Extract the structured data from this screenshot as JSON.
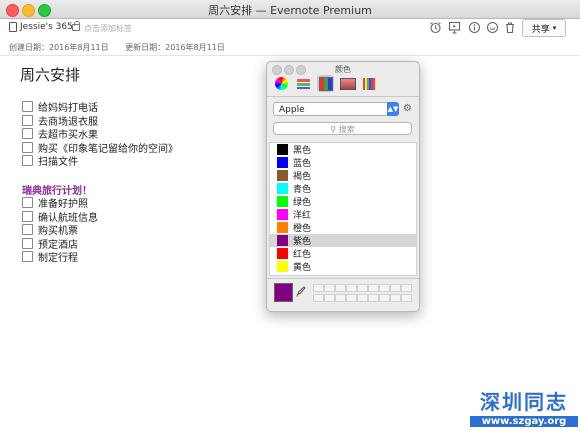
{
  "window": {
    "title": "周六安排 — Evernote Premium"
  },
  "toolbar": {
    "notebook": "Jessie's 365",
    "tag_placeholder": "点击添加标签",
    "share_label": "共享"
  },
  "dates": {
    "created": "创建日期：2016年8月11日",
    "updated": "更新日期：2016年8月11日"
  },
  "note": {
    "title": "周六安排",
    "todos": [
      {
        "label": "给妈妈打电话",
        "checked": false
      },
      {
        "label": "去商场退衣服",
        "checked": false
      },
      {
        "label": "去超市买水果",
        "checked": false
      },
      {
        "label": "购买《印象笔记留给你的空间》",
        "checked": false
      },
      {
        "label": "扫描文件",
        "checked": false
      }
    ],
    "section_title": "瑞典旅行计划！",
    "section_color": "#8a2d96",
    "travel_todos": [
      {
        "label": "准备好护照",
        "checked": false
      },
      {
        "label": "确认航班信息",
        "checked": false
      },
      {
        "label": "购买机票",
        "checked": false
      },
      {
        "label": "预定酒店",
        "checked": false
      },
      {
        "label": "制定行程",
        "checked": false
      }
    ]
  },
  "color_panel": {
    "title": "颜色",
    "palette_name": "Apple",
    "search_placeholder": "搜索",
    "colors": [
      {
        "name": "黑色",
        "hex": "#000000"
      },
      {
        "name": "蓝色",
        "hex": "#0000ff"
      },
      {
        "name": "褐色",
        "hex": "#8b5a2b"
      },
      {
        "name": "青色",
        "hex": "#00ffff"
      },
      {
        "name": "绿色",
        "hex": "#00ff00"
      },
      {
        "name": "洋红",
        "hex": "#ff00ff"
      },
      {
        "name": "橙色",
        "hex": "#ff8000"
      },
      {
        "name": "紫色",
        "hex": "#800080"
      },
      {
        "name": "红色",
        "hex": "#ff0000"
      },
      {
        "name": "黄色",
        "hex": "#ffff00"
      }
    ],
    "selected_index": 7,
    "current_color": "#7f0080"
  },
  "watermark": {
    "line1": "深圳同志",
    "line2": "www.szgay.org"
  }
}
